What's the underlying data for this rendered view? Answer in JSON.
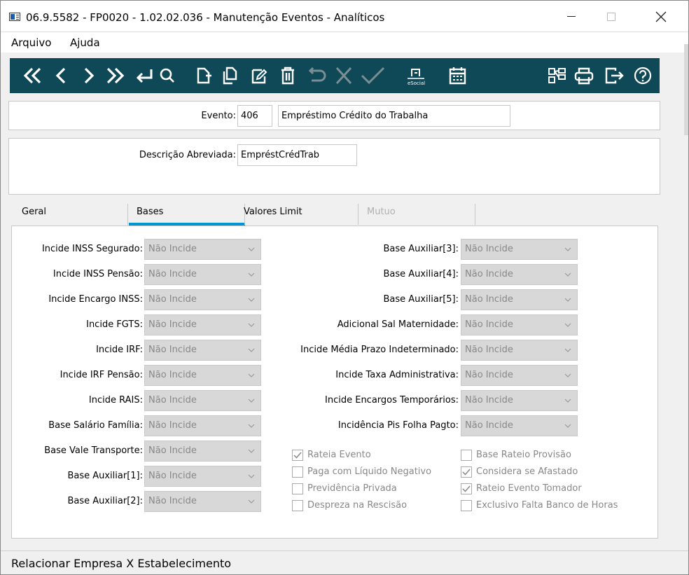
{
  "window": {
    "title": "06.9.5582 - FP0020 - 1.02.02.036 - Manutenção Eventos - Analíticos",
    "controls": {
      "minimize": "minimize",
      "maximize": "maximize",
      "close": "✕"
    }
  },
  "menu": {
    "items": [
      "Arquivo",
      "Ajuda"
    ]
  },
  "toolbar": {
    "icons": [
      "first-icon",
      "previous-icon",
      "next-icon",
      "last-icon",
      "enter-icon",
      "search-icon",
      "new-icon",
      "copy-icon",
      "edit-icon",
      "delete-icon",
      "undo-icon",
      "cancel-icon",
      "confirm-icon",
      "esocial-icon",
      "calendar-icon",
      "tree-icon",
      "print-icon",
      "exit-icon",
      "help-icon"
    ],
    "esocial_label": "eSocial",
    "color": "#0f4957"
  },
  "evento": {
    "label": "Evento:",
    "code": "406",
    "name": "Empréstimo Crédito do Trabalha"
  },
  "descricao": {
    "label": "Descrição Abreviada:",
    "value": "EmpréstCrédTrab"
  },
  "tabs": [
    {
      "label": "Geral"
    },
    {
      "label": "Bases"
    },
    {
      "label": "Valores Limit"
    },
    {
      "label": "Mutuo"
    }
  ],
  "active_tab": "Bases",
  "accent_color": "#0096d6",
  "left_fields": [
    {
      "label": "Incide INSS Segurado:",
      "value": "Não Incide"
    },
    {
      "label": "Incide INSS Pensão:",
      "value": "Não Incide"
    },
    {
      "label": "Incide Encargo INSS:",
      "value": "Não Incide"
    },
    {
      "label": "Incide FGTS:",
      "value": "Não Incide"
    },
    {
      "label": "Incide IRF:",
      "value": "Não Incide"
    },
    {
      "label": "Incide IRF Pensão:",
      "value": "Não Incide"
    },
    {
      "label": "Incide RAIS:",
      "value": "Não Incide"
    },
    {
      "label": "Base Salário Família:",
      "value": "Não Incide"
    },
    {
      "label": "Base Vale Transporte:",
      "value": "Não Incide"
    },
    {
      "label": "Base Auxiliar[1]:",
      "value": "Não Incide"
    },
    {
      "label": "Base Auxiliar[2]:",
      "value": "Não Incide"
    }
  ],
  "right_fields": [
    {
      "label": "Base Auxiliar[3]:",
      "value": "Não Incide"
    },
    {
      "label": "Base Auxiliar[4]:",
      "value": "Não Incide"
    },
    {
      "label": "Base Auxiliar[5]:",
      "value": "Não Incide"
    },
    {
      "label": "Adicional Sal Maternidade:",
      "value": "Não Incide"
    },
    {
      "label": "Incide Média Prazo Indeterminado:",
      "value": "Não Incide"
    },
    {
      "label": "Incide Taxa Administrativa:",
      "value": "Não Incide"
    },
    {
      "label": "Incide Encargos Temporários:",
      "value": "Não Incide"
    },
    {
      "label": "Incidência Pis Folha Pagto:",
      "value": "Não Incide"
    }
  ],
  "checkboxes_left": [
    {
      "label": "Rateia Evento",
      "checked": true
    },
    {
      "label": "Paga com Líquido Negativo",
      "checked": false
    },
    {
      "label": "Previdência Privada",
      "checked": false
    },
    {
      "label": "Despreza na Rescisão",
      "checked": false
    }
  ],
  "checkboxes_right": [
    {
      "label": "Base Rateio Provisão",
      "checked": false
    },
    {
      "label": "Considera se Afastado",
      "checked": true
    },
    {
      "label": "Rateio Evento Tomador",
      "checked": true
    },
    {
      "label": "Exclusivo Falta Banco de Horas",
      "checked": false
    }
  ],
  "status": {
    "text": "Relacionar Empresa X Estabelecimento"
  }
}
